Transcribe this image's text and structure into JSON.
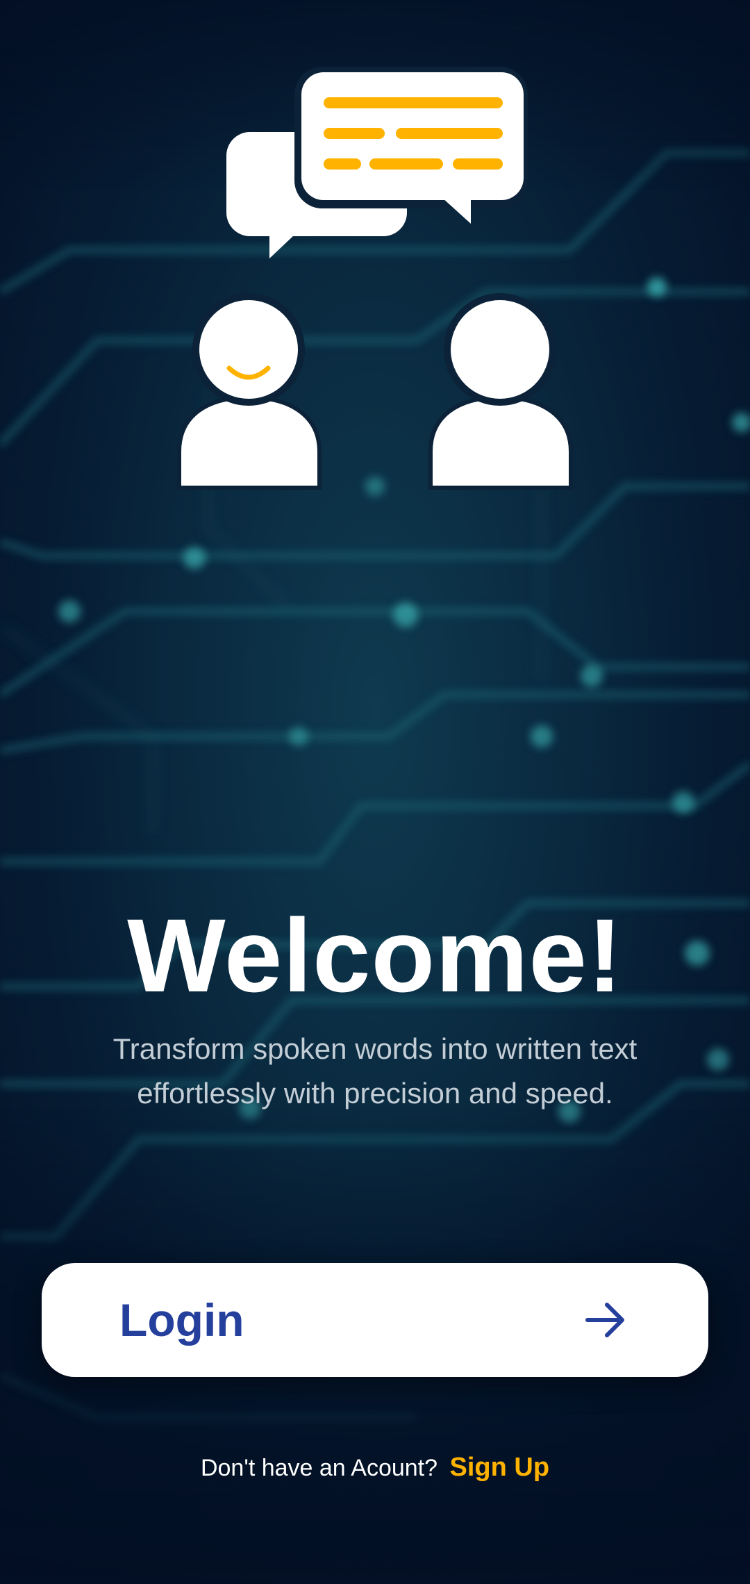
{
  "welcome": {
    "title": "Welcome!",
    "subtitle_line1": "Transform spoken words into written text",
    "subtitle_line2": "effortlessly with precision and speed."
  },
  "login": {
    "label": "Login",
    "icon": "arrow-right-icon"
  },
  "signup": {
    "prompt": "Don't have an Acount?",
    "link": "Sign Up"
  },
  "illustration": {
    "icons": [
      "chat-bubbles-icon",
      "smiling-user-icon",
      "user-icon"
    ]
  },
  "colors": {
    "background": "#031126",
    "accent": "#ffb300",
    "button_text": "#243f9c",
    "button_bg": "#ffffff",
    "title": "#ffffff",
    "subtitle": "#c3cdd6"
  }
}
